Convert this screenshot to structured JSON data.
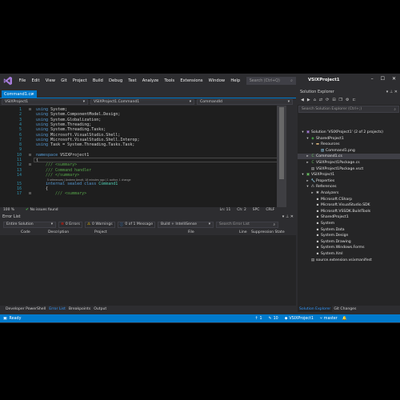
{
  "menu": {
    "items": [
      "File",
      "Edit",
      "View",
      "Git",
      "Project",
      "Build",
      "Debug",
      "Test",
      "Analyze",
      "Tools",
      "Extensions",
      "Window",
      "Help"
    ],
    "search_placeholder": "Search (Ctrl+Q)",
    "window_title": "VSIXProject1"
  },
  "editor": {
    "tab_label": "Command1.cs",
    "nav": {
      "project": "VSIXProject1",
      "type": "VSIXProject1.Command1",
      "member": "CommandId"
    },
    "lines": [
      {
        "n": "1",
        "code": [
          "using",
          " System;"
        ]
      },
      {
        "n": "2",
        "code": [
          "using",
          " System.ComponentModel.Design;"
        ]
      },
      {
        "n": "3",
        "code": [
          "using",
          " System.Globalization;"
        ]
      },
      {
        "n": "4",
        "code": [
          "using",
          " System.Threading;"
        ]
      },
      {
        "n": "5",
        "code": [
          "using",
          " System.Threading.Tasks;"
        ]
      },
      {
        "n": "6",
        "code": [
          "using",
          " Microsoft.VisualStudio.Shell;"
        ]
      },
      {
        "n": "7",
        "code": [
          "using",
          " Microsoft.VisualStudio.Shell.Interop;"
        ]
      },
      {
        "n": "8",
        "code": [
          "using",
          " Task = System.Threading.Tasks.Task;"
        ]
      },
      {
        "n": "9",
        "code": [
          "",
          ""
        ]
      },
      {
        "n": "10",
        "code": [
          "namespace",
          " VSIXProject1"
        ]
      },
      {
        "n": "11",
        "code": [
          "",
          "{"
        ]
      },
      {
        "n": "12",
        "code": [
          "///",
          " <summary>"
        ]
      },
      {
        "n": "13",
        "code": [
          "///",
          " Command handler"
        ]
      },
      {
        "n": "14",
        "code": [
          "///",
          " </summary>"
        ]
      },
      {
        "n": "15",
        "code": [
          "internal sealed class",
          " Command1"
        ]
      },
      {
        "n": "16",
        "code": [
          "",
          "{"
        ]
      },
      {
        "n": "17",
        "code": [
          "///",
          " <summary>"
        ]
      }
    ],
    "codelens": "5 references | Andrew Arnott, 18 minutes ago | 1 author, 1 change",
    "status": {
      "zoom": "100 %",
      "issues": "No issues found",
      "ln": "Ln: 11",
      "ch": "Ch: 2",
      "spc": "SPC",
      "crlf": "CRLF"
    }
  },
  "error_list": {
    "title": "Error List",
    "scope": "Entire Solution",
    "errors": "0 Errors",
    "warnings": "0 Warnings",
    "messages": "0 of 1 Message",
    "build_filter": "Build + IntelliSense",
    "search_placeholder": "Search Error List",
    "columns": [
      "Code",
      "Description",
      "Project",
      "File",
      "Line",
      "Suppression State"
    ]
  },
  "bottom_tabs": [
    "Developer PowerShell",
    "Error List",
    "Breakpoints",
    "Output"
  ],
  "solution_explorer": {
    "title": "Solution Explorer",
    "search_placeholder": "Search Solution Explorer (Ctrl+;)",
    "items": [
      {
        "label": "Solution 'VSIXProject1' (2 of 2 projects)",
        "icon": "solution-icon"
      },
      {
        "label": "SharedProject1",
        "icon": "shared-project-icon"
      },
      {
        "label": "Resources",
        "icon": "folder-icon"
      },
      {
        "label": "Command1.png",
        "icon": "image-file-icon"
      },
      {
        "label": "Command1.cs",
        "icon": "csharp-file-icon"
      },
      {
        "label": "VSIXProject1Package.cs",
        "icon": "csharp-file-icon"
      },
      {
        "label": "VSIXProject1Package.vsct",
        "icon": "vsct-file-icon"
      },
      {
        "label": "VSIXProject1",
        "icon": "csharp-project-icon"
      },
      {
        "label": "Properties",
        "icon": "properties-icon"
      },
      {
        "label": "References",
        "icon": "references-icon"
      },
      {
        "label": "Analyzers",
        "icon": "analyzers-icon"
      },
      {
        "label": "Microsoft.CSharp",
        "icon": "reference-icon"
      },
      {
        "label": "Microsoft.VisualStudio.SDK",
        "icon": "reference-icon"
      },
      {
        "label": "Microsoft.VSSDK.BuildTools",
        "icon": "reference-icon"
      },
      {
        "label": "SharedProject1",
        "icon": "reference-icon"
      },
      {
        "label": "System",
        "icon": "reference-icon"
      },
      {
        "label": "System.Data",
        "icon": "reference-icon"
      },
      {
        "label": "System.Design",
        "icon": "reference-icon"
      },
      {
        "label": "System.Drawing",
        "icon": "reference-icon"
      },
      {
        "label": "System.Windows.Forms",
        "icon": "reference-icon"
      },
      {
        "label": "System.Xml",
        "icon": "reference-icon"
      },
      {
        "label": "source.extension.vsixmanifest",
        "icon": "manifest-icon"
      }
    ],
    "tabs": [
      "Solution Explorer",
      "Git Changes"
    ]
  },
  "statusbar": {
    "state": "Ready",
    "up": "1",
    "edits": "10",
    "repo": "VSIXProject1",
    "branch": "master"
  },
  "colors": {
    "accent": "#007acc",
    "keyword": "#569cd6",
    "type": "#4ec9b0",
    "comment": "#57a64a"
  }
}
